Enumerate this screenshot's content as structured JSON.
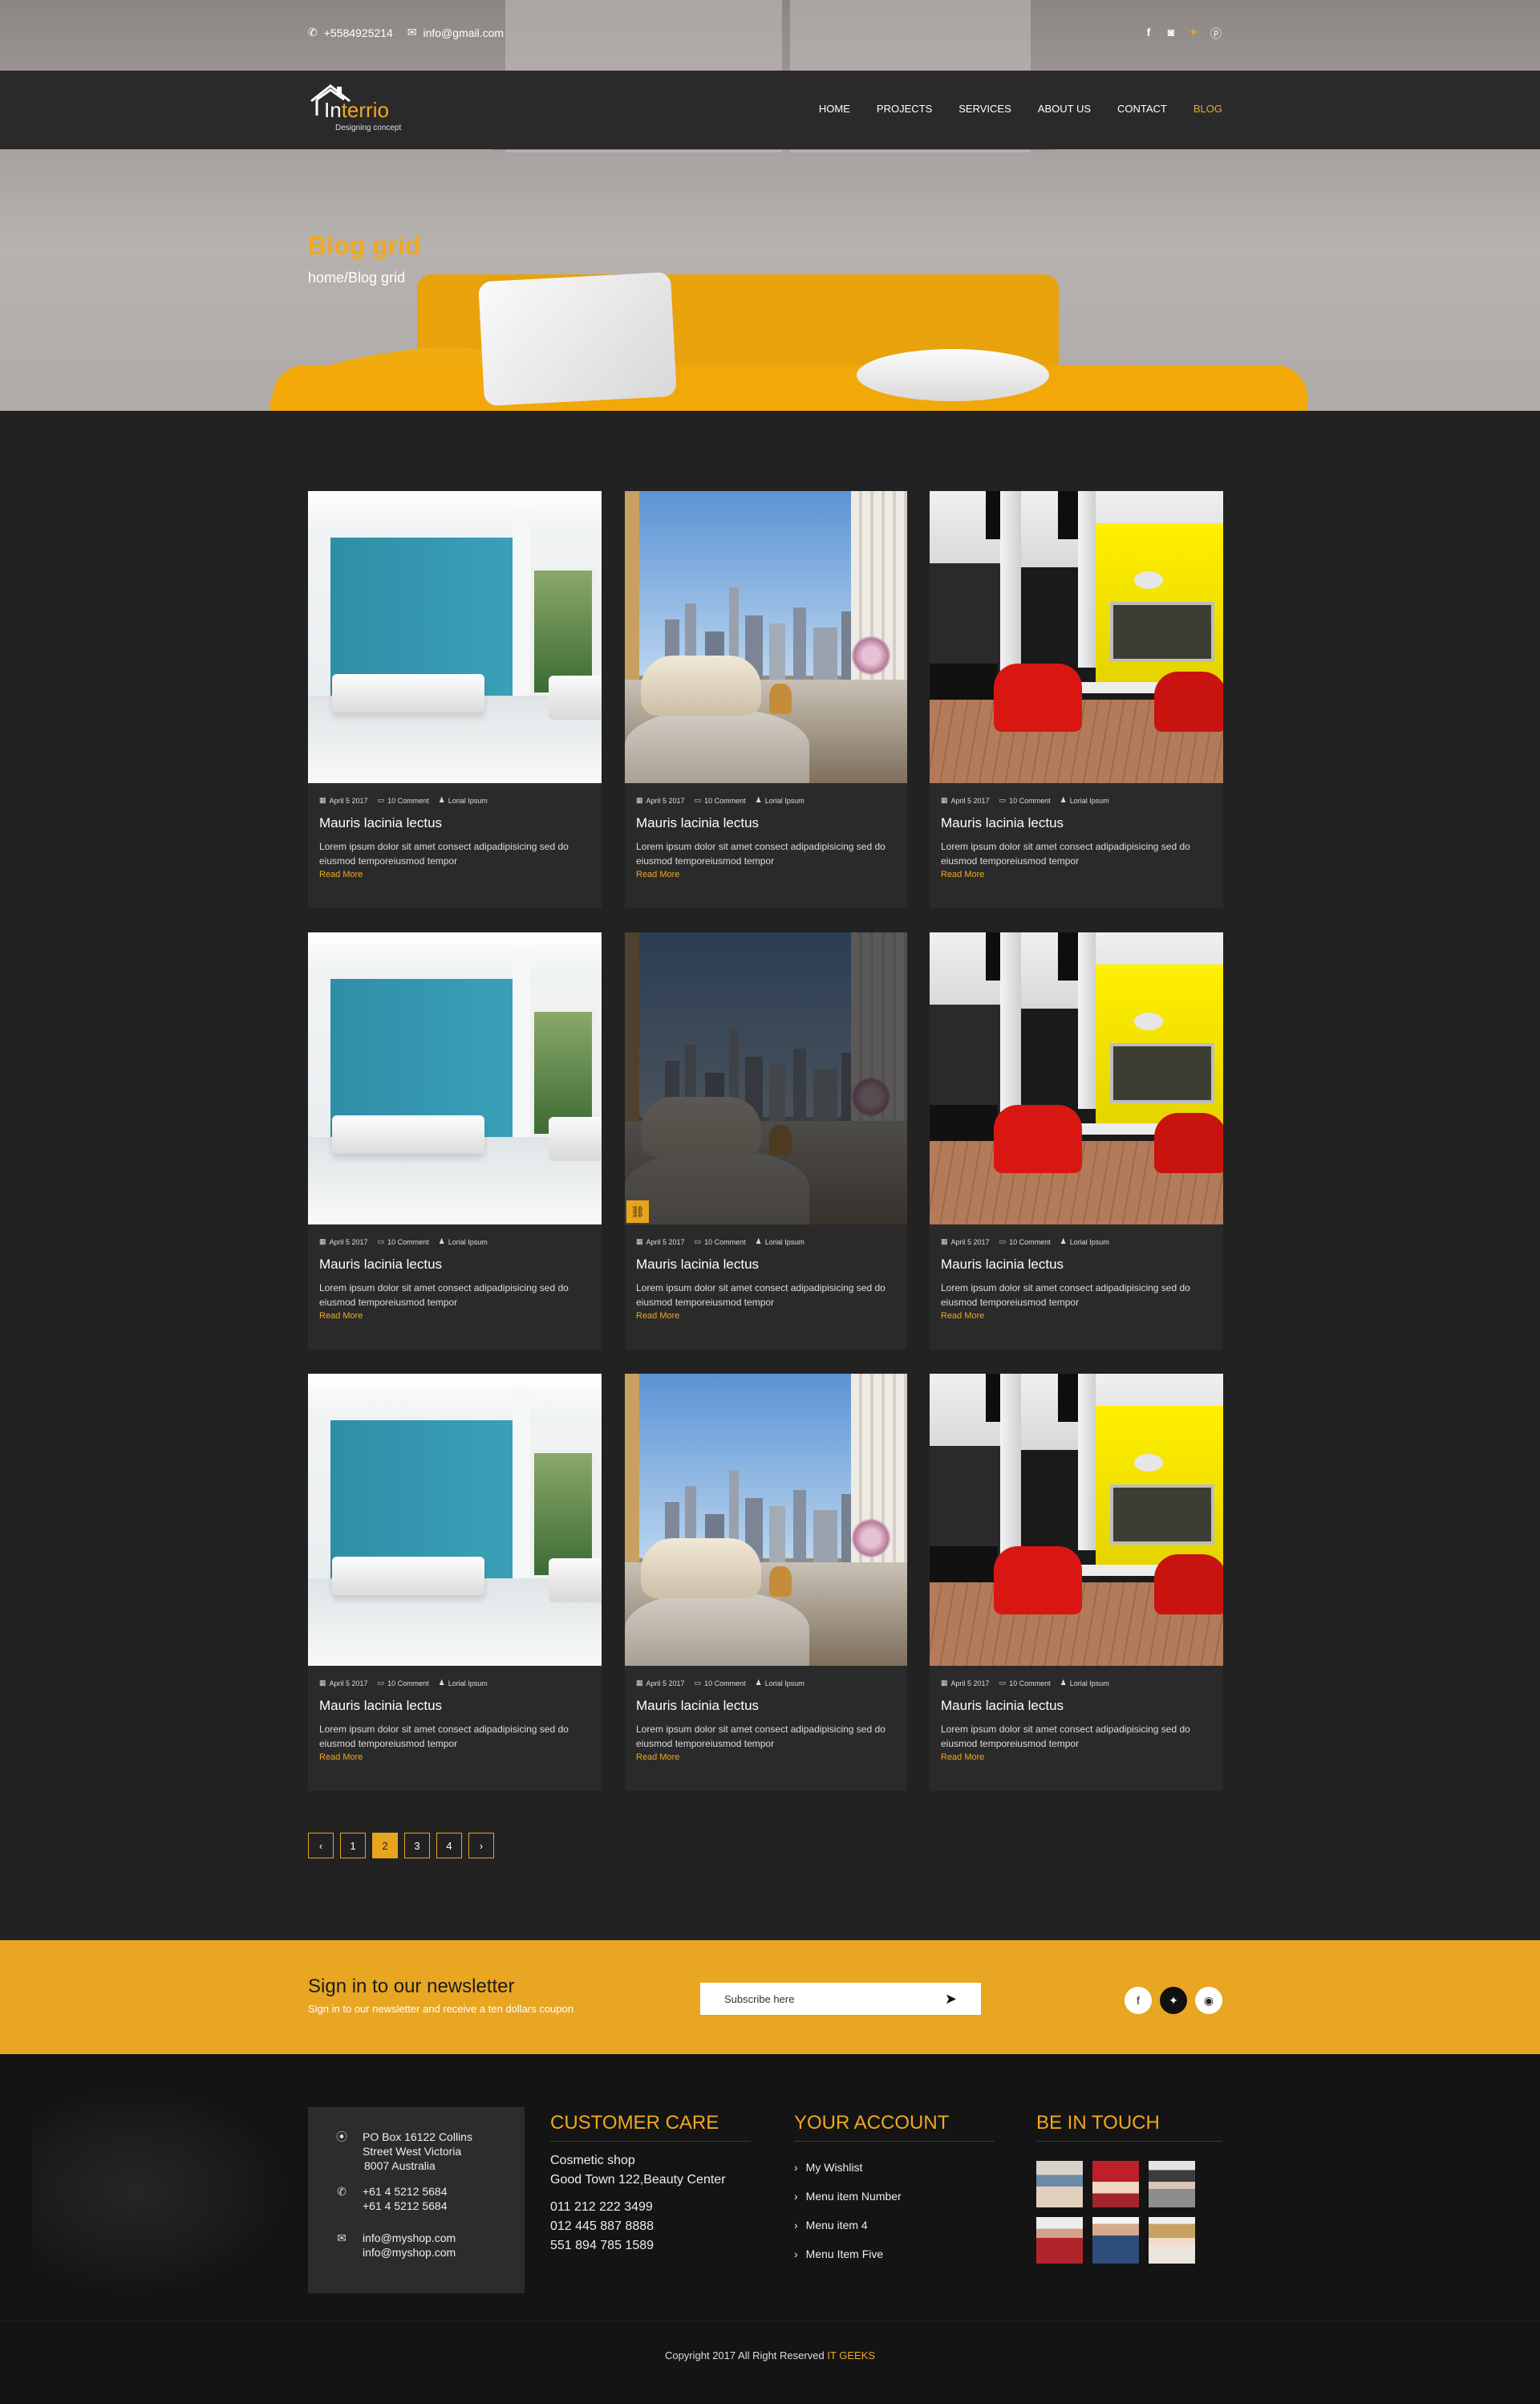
{
  "topbar": {
    "phone": "+5584925214",
    "email": "info@gmail.com",
    "social": [
      "facebook-icon",
      "instagram-icon",
      "twitter-icon",
      "pinterest-icon"
    ]
  },
  "brand": {
    "name_first": "In",
    "name_rest": "terrio",
    "tagline": "Designing concept"
  },
  "nav": {
    "items": [
      "HOME",
      "PROJECTS",
      "SERVICES",
      "ABOUT US",
      "CONTACT",
      "BLOG"
    ],
    "active": "BLOG"
  },
  "hero": {
    "title": "Blog grid",
    "breadcrumb": "home/Blog grid"
  },
  "posts": [
    {
      "date": "April 5 2017",
      "comments": "10 Comment",
      "author": "Lorial Ipsum",
      "title": "Mauris lacinia lectus",
      "excerpt": "Lorem ipsum dolor sit amet consect adipadipisicing sed do eiusmod temporeiusmod tempor",
      "more": "Read More"
    },
    {
      "date": "April 5 2017",
      "comments": "10 Comment",
      "author": "Lorial Ipsum",
      "title": "Mauris lacinia lectus",
      "excerpt": "Lorem ipsum dolor sit amet consect adipadipisicing sed do eiusmod temporeiusmod tempor",
      "more": "Read More"
    },
    {
      "date": "April 5 2017",
      "comments": "10 Comment",
      "author": "Lorial Ipsum",
      "title": "Mauris lacinia lectus",
      "excerpt": "Lorem ipsum dolor sit amet consect adipadipisicing sed do eiusmod temporeiusmod tempor",
      "more": "Read More"
    },
    {
      "date": "April 5 2017",
      "comments": "10 Comment",
      "author": "Lorial Ipsum",
      "title": "Mauris lacinia lectus",
      "excerpt": "Lorem ipsum dolor sit amet consect adipadipisicing sed do eiusmod temporeiusmod tempor",
      "more": "Read More"
    },
    {
      "date": "April 5 2017",
      "comments": "10 Comment",
      "author": "Lorial Ipsum",
      "title": "Mauris lacinia lectus",
      "excerpt": "Lorem ipsum dolor sit amet consect adipadipisicing sed do eiusmod temporeiusmod tempor",
      "more": "Read More"
    },
    {
      "date": "April 5 2017",
      "comments": "10 Comment",
      "author": "Lorial Ipsum",
      "title": "Mauris lacinia lectus",
      "excerpt": "Lorem ipsum dolor sit amet consect adipadipisicing sed do eiusmod temporeiusmod tempor",
      "more": "Read More"
    },
    {
      "date": "April 5 2017",
      "comments": "10 Comment",
      "author": "Lorial Ipsum",
      "title": "Mauris lacinia lectus",
      "excerpt": "Lorem ipsum dolor sit amet consect adipadipisicing sed do eiusmod temporeiusmod tempor",
      "more": "Read More"
    },
    {
      "date": "April 5 2017",
      "comments": "10 Comment",
      "author": "Lorial Ipsum",
      "title": "Mauris lacinia lectus",
      "excerpt": "Lorem ipsum dolor sit amet consect adipadipisicing sed do eiusmod temporeiusmod tempor",
      "more": "Read More"
    },
    {
      "date": "April 5 2017",
      "comments": "10 Comment",
      "author": "Lorial Ipsum",
      "title": "Mauris lacinia lectus",
      "excerpt": "Lorem ipsum dolor sit amet consect adipadipisicing sed do eiusmod temporeiusmod tempor",
      "more": "Read More"
    }
  ],
  "pagination": {
    "prev": "‹",
    "pages": [
      "1",
      "2",
      "3",
      "4"
    ],
    "active": "2",
    "next": "›"
  },
  "newsletter": {
    "title": "Sign in to our newsletter",
    "subtitle": "Sign in to our newsletter and receive a ten  dollars coupon",
    "placeholder": "Subscribe here",
    "social": [
      "facebook-icon",
      "twitter-icon",
      "rss-icon"
    ]
  },
  "footer": {
    "address": [
      "PO Box 16122 Collins",
      "Street West Victoria",
      "8007 Australia"
    ],
    "phones": [
      "+61 4 5212 5684",
      "+61 4 5212 5684"
    ],
    "emails": [
      "info@myshop.com",
      "info@myshop.com"
    ],
    "customer_care": {
      "title": "CUSTOMER CARE",
      "shop": "Cosmetic shop",
      "location": "Good Town 122,Beauty Center",
      "phones": [
        "011 212 222 3499",
        "012 445 887 8888",
        "551 894 785 1589"
      ]
    },
    "your_account": {
      "title": "YOUR ACCOUNT",
      "items": [
        "My Wishlist",
        "Menu item Number",
        "Menu item 4",
        "Menu Item Five"
      ]
    },
    "be_in_touch": {
      "title": "BE IN TOUCH"
    },
    "copyright": "Copyright 2017  All Right Reserved",
    "copyright_brand": "IT GEEKS"
  },
  "colors": {
    "accent": "#f0a81f",
    "dark_bg": "#222223",
    "card_bg": "#2a2a2b",
    "newsletter_bg": "#e8a623"
  }
}
